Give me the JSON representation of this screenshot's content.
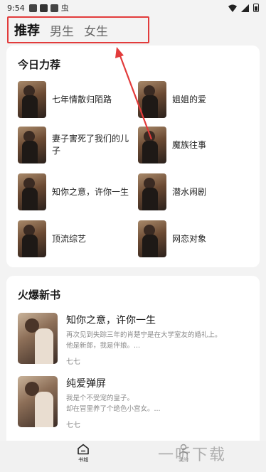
{
  "status_bar": {
    "time": "9:54",
    "app_icon_letter": "虫"
  },
  "tabs": [
    {
      "label": "推荐",
      "active": true
    },
    {
      "label": "男生",
      "active": false
    },
    {
      "label": "女生",
      "active": false
    }
  ],
  "today": {
    "title": "今日力荐",
    "items": [
      {
        "name": "七年情散归陌路"
      },
      {
        "name": "姐姐的爱"
      },
      {
        "name": "妻子害死了我们的儿子"
      },
      {
        "name": "魔族往事"
      },
      {
        "name": "知你之意，许你一生"
      },
      {
        "name": "潜水闹剧"
      },
      {
        "name": "顶流综艺"
      },
      {
        "name": "网恋对象"
      }
    ]
  },
  "hot_new": {
    "title": "火爆新书",
    "items": [
      {
        "title": "知你之意，许你一生",
        "desc_line1": "再次见到失踪三年的肖楚宁是在大学室友的婚礼上。",
        "desc_line2": "他是新郎，我是伴娘。...",
        "author": "七七"
      },
      {
        "title": "纯爱弹屏",
        "desc_line1": "我是个不受宠的皇子。",
        "desc_line2": "却在冒里养了个绝色小宫女。...",
        "author": "七七"
      }
    ]
  },
  "bottom_nav": {
    "books_label": "书城",
    "mine_label": "我的"
  },
  "watermark": "一听下载",
  "colors": {
    "highlight_red": "#e23b3b",
    "background": "#f3f3f3"
  }
}
